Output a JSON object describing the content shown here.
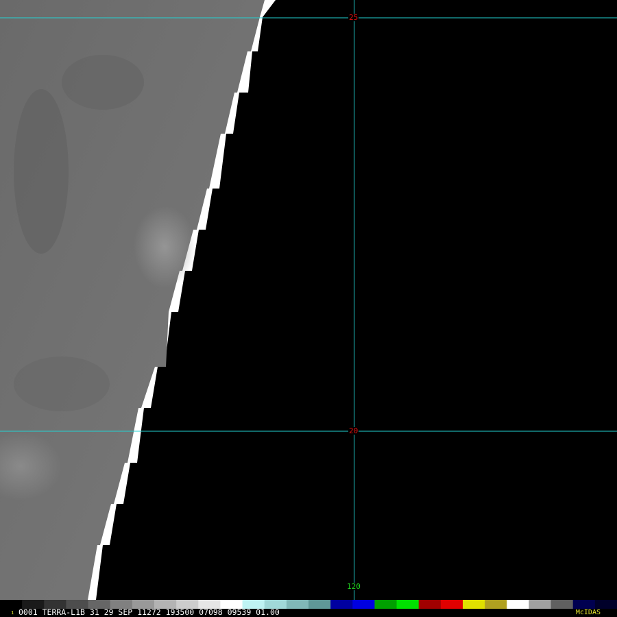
{
  "overlay": {
    "grid_color": "#22d3d3",
    "lat_label_color": "#e01010",
    "lon_label_color": "#20d020",
    "latitude_lines": [
      {
        "label": "25"
      },
      {
        "label": "20"
      }
    ],
    "longitude_lines": [
      {
        "label": "120"
      }
    ]
  },
  "imagery": {
    "palette": "grayscale",
    "land_tone": "#6e6e6e",
    "bright_tone": "#8c8c8c",
    "edge_tone": "#ffffff",
    "background": "#000000"
  },
  "status": {
    "frame_number": "1",
    "info_text": "0001 TERRA-L1B 31 29 SEP 11272 193500 07098 09539 01.00",
    "info_color": "#ffffff",
    "brand": "McIDAS",
    "brand_color": "#e8e830"
  },
  "colorbar": {
    "segments": [
      "#000000",
      "#1a1a1a",
      "#333333",
      "#4d4d4d",
      "#666666",
      "#808080",
      "#999999",
      "#b3b3b3",
      "#cccccc",
      "#e6e6e6",
      "#ffffff",
      "#bff3f3",
      "#a0d8d8",
      "#80b8b8",
      "#5f9898",
      "#0000a0",
      "#0000e0",
      "#00a000",
      "#00e000",
      "#a00000",
      "#e00000",
      "#e0e000",
      "#b0a020",
      "#ffffff",
      "#a0a0a0",
      "#606060",
      "#000050",
      "#00002a"
    ]
  }
}
